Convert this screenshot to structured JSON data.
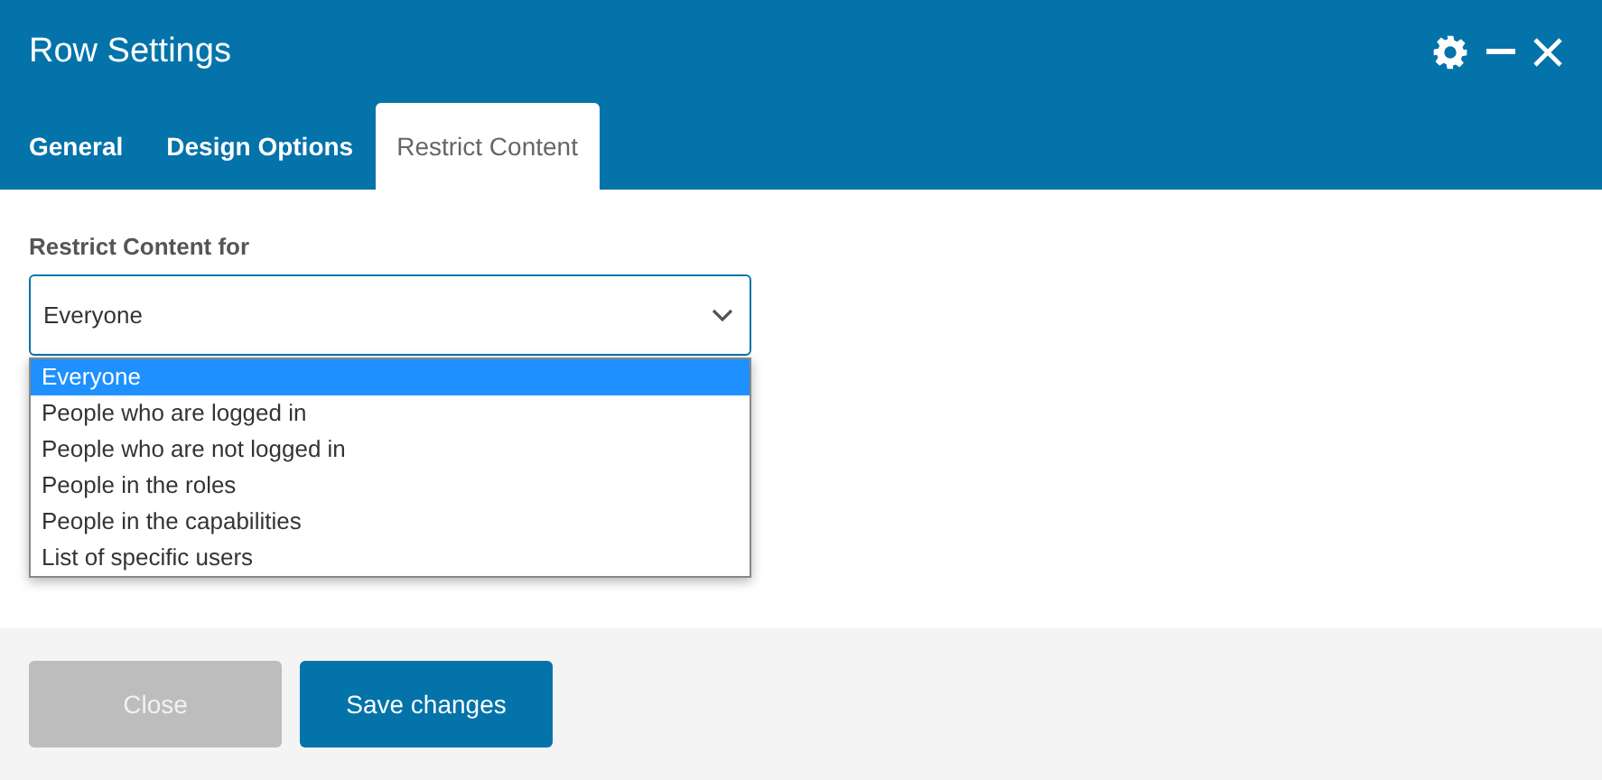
{
  "window": {
    "title": "Row Settings"
  },
  "tabs": [
    {
      "label": "General",
      "selected": false
    },
    {
      "label": "Design Options",
      "selected": false
    },
    {
      "label": "Restrict Content",
      "selected": true
    }
  ],
  "restrict": {
    "label": "Restrict Content for",
    "value": "Everyone",
    "expanded": true,
    "options": [
      {
        "label": "Everyone",
        "selected": true
      },
      {
        "label": "People who are logged in",
        "selected": false
      },
      {
        "label": "People who are not logged in",
        "selected": false
      },
      {
        "label": "People in the roles",
        "selected": false
      },
      {
        "label": "People in the capabilities",
        "selected": false
      },
      {
        "label": "List of specific users",
        "selected": false
      }
    ]
  },
  "buttons": [
    {
      "label": "Close",
      "disabled": true
    },
    {
      "label": "Save changes",
      "disabled": false
    }
  ]
}
